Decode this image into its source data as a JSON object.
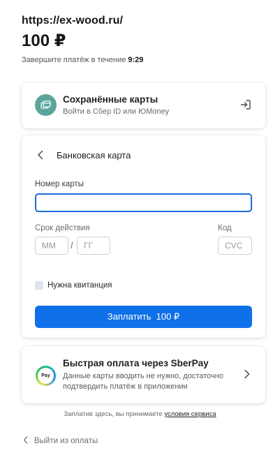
{
  "header": {
    "merchant": "https://ex-wood.ru/",
    "amount": "100 ₽",
    "timer_text": "Завершите платёж в течение ",
    "timer_value": "9:29"
  },
  "saved_cards": {
    "title": "Сохранённые карты",
    "subtitle": "Войти в Сбер ID или ЮMoney",
    "icon": "card-icon",
    "action_icon": "login-icon"
  },
  "bank_card": {
    "title": "Банковская карта",
    "card_number_label": "Номер карты",
    "card_number_value": "",
    "expiry_label": "Срок действия",
    "month_placeholder": "ММ",
    "year_placeholder": "ГГ",
    "separator": "/",
    "cvc_label": "Код",
    "cvc_placeholder": "CVC",
    "receipt_label": "Нужна квитанция",
    "pay_button": "Заплатить  100 ₽"
  },
  "sberpay": {
    "title": "Быстрая оплата через SberPay",
    "subtitle": "Данные карты вводить не нужно, достаточно подтвердить платёж в приложении",
    "logo_text": "Pay"
  },
  "footer": {
    "terms_prefix": "Заплатив здесь, вы принимаете ",
    "terms_link": "условия сервиса",
    "exit_label": "Выйти из оплаты"
  },
  "colors": {
    "accent": "#1070e8",
    "saved_icon": "#5aa49b"
  }
}
